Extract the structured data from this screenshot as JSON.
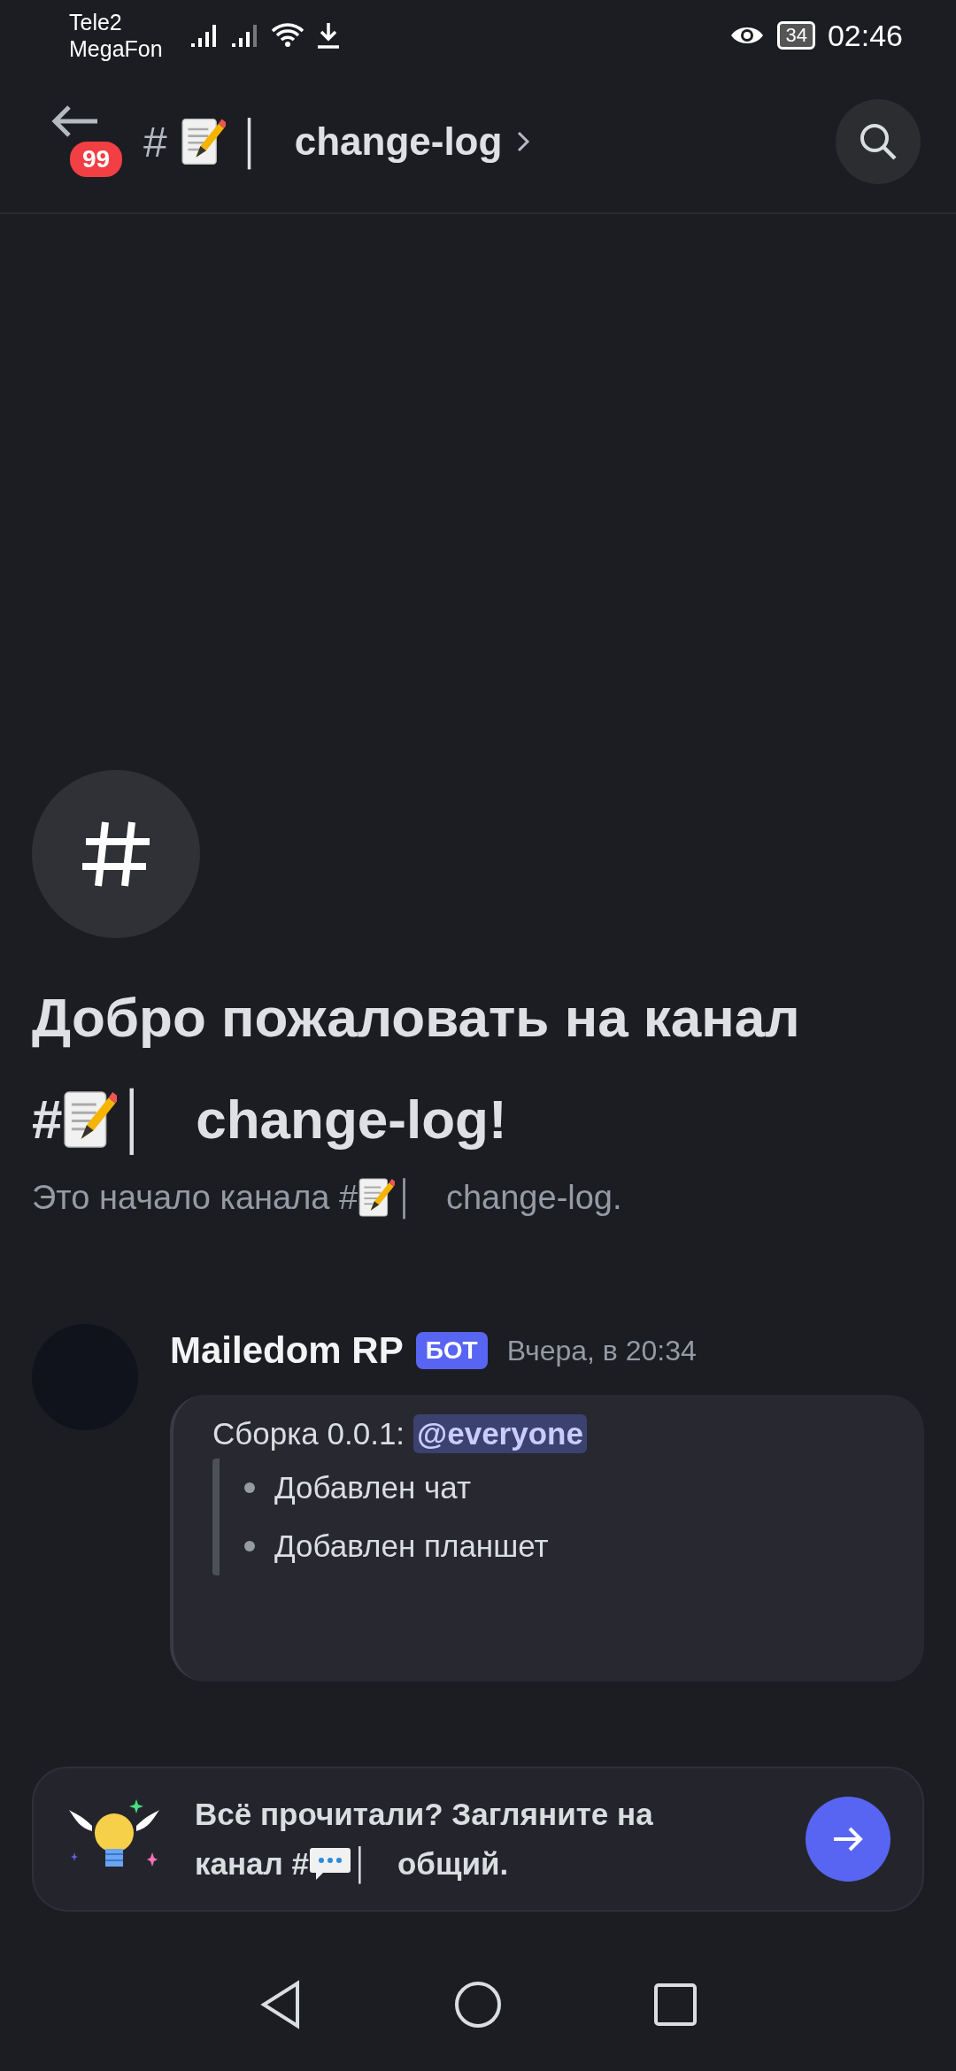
{
  "status_bar": {
    "carriers": [
      "Tele2",
      "MegaFon"
    ],
    "battery": "34",
    "time": "02:46"
  },
  "header": {
    "badge": "99",
    "hash": "#",
    "separator": "│",
    "channel": "change-log"
  },
  "welcome": {
    "title": "Добро пожаловать на канал",
    "hash": "#",
    "separator": "│",
    "channel": "change-log!",
    "subtitle": "Это начало канала",
    "subtitle_hash": "#",
    "subtitle_separator": "│",
    "subtitle_channel": "change-log."
  },
  "message": {
    "author": "Mailedom RP",
    "badge": "БОТ",
    "time": "Вчера, в 20:34",
    "embed": {
      "heading": "Сборка 0.0.1:",
      "mention": "@everyone",
      "items": [
        "Добавлен чат",
        "Добавлен планшет"
      ]
    }
  },
  "suggestion": {
    "text": "Всё прочитали? Загляните на",
    "text_line2": "канал",
    "hash": "#",
    "separator": "│",
    "channel": "общий."
  }
}
